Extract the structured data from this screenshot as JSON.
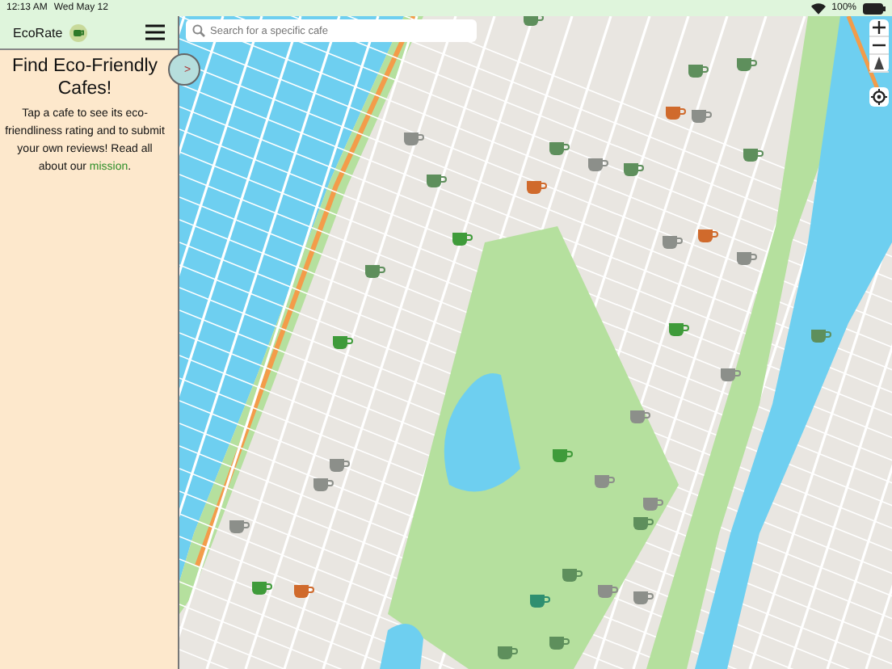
{
  "status_bar": {
    "time": "12:13 AM",
    "date": "Wed May 12",
    "battery": "100%"
  },
  "sidebar": {
    "app_name": "EcoRate",
    "heading": "Find Eco-Friendly Cafes!",
    "intro_before": "Tap a cafe to see its eco-friendliness rating and to submit your own reviews! Read all about our ",
    "intro_link": "mission",
    "intro_after": ".",
    "toggle": ">"
  },
  "search": {
    "placeholder": "Search for a specific cafe"
  }
}
